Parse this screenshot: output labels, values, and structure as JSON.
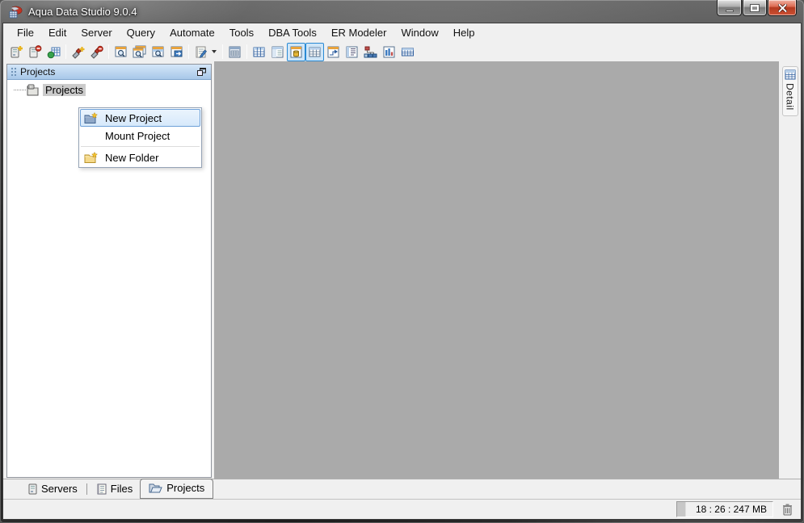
{
  "titlebar": {
    "title": "Aqua Data Studio 9.0.4"
  },
  "menubar": {
    "items": [
      "File",
      "Edit",
      "Server",
      "Query",
      "Automate",
      "Tools",
      "DBA Tools",
      "ER Modeler",
      "Window",
      "Help"
    ]
  },
  "toolbar": {
    "group_server": [
      {
        "icon": "register-server-icon"
      },
      {
        "icon": "remove-server-icon"
      },
      {
        "icon": "server-connections-icon"
      },
      {
        "icon": "connect-server-icon"
      },
      {
        "icon": "disconnect-server-icon"
      },
      {
        "icon": "query-analyzer-icon"
      },
      {
        "icon": "query-analyzer-windows-icon"
      },
      {
        "icon": "query-window-icon"
      },
      {
        "icon": "arrange-windows-icon"
      },
      {
        "icon": "edit-script-icon",
        "has_dropdown": true
      }
    ],
    "group_view": [
      {
        "icon": "schema-browser-icon",
        "selected": false
      },
      {
        "icon": "table-grid-icon",
        "selected": false
      },
      {
        "icon": "window-detail-icon",
        "selected": false
      },
      {
        "icon": "database-objects-icon",
        "selected": true
      },
      {
        "icon": "grid-results-icon",
        "selected": true
      },
      {
        "icon": "er-diagram-icon",
        "selected": false
      },
      {
        "icon": "ddl-text-icon",
        "selected": false
      },
      {
        "icon": "hierarchy-icon",
        "selected": false
      },
      {
        "icon": "statistics-chart-icon",
        "selected": false
      },
      {
        "icon": "wide-table-icon",
        "selected": false
      }
    ]
  },
  "projects_panel": {
    "header_title": "Projects",
    "float_icon": "float-panel-icon",
    "tree": {
      "root_label": "Projects",
      "root_icon": "project-folder-icon",
      "selected": true
    }
  },
  "context_menu": {
    "items": [
      {
        "label": "New Project",
        "icon": "new-project-icon",
        "highlighted": true
      },
      {
        "label": "Mount Project",
        "icon": null,
        "highlighted": false
      },
      {
        "label": "New Folder",
        "icon": "new-folder-icon",
        "highlighted": false,
        "separator_before": true
      }
    ]
  },
  "right_panel": {
    "tab_label": "Detail",
    "tab_icon": "detail-grid-icon"
  },
  "bottom_tabs": {
    "tabs": [
      {
        "label": "Servers",
        "icon": "servers-tab-icon",
        "active": false
      },
      {
        "label": "Files",
        "icon": "files-tab-icon",
        "active": false
      },
      {
        "label": "Projects",
        "icon": "projects-tab-icon",
        "active": true
      }
    ]
  },
  "statusbar": {
    "memory_text": "18 : 26 : 247 MB",
    "trash_icon": "trash-icon"
  },
  "window_controls": [
    "minimize",
    "restore",
    "close"
  ],
  "colors": {
    "toolbar_selected_fill": "#cfe6f8",
    "toolbar_selected_border": "#2a8ad4",
    "panel_header_top": "#d4e6f8",
    "panel_header_bottom": "#a8c8e9",
    "menu_highlight_fill": "#d7e9fb",
    "menu_highlight_border": "#6ea1d8",
    "main_area_gray": "#aaaaaa",
    "chrome_gray": "#f0f0f0",
    "close_button_red": "#b33a20"
  }
}
